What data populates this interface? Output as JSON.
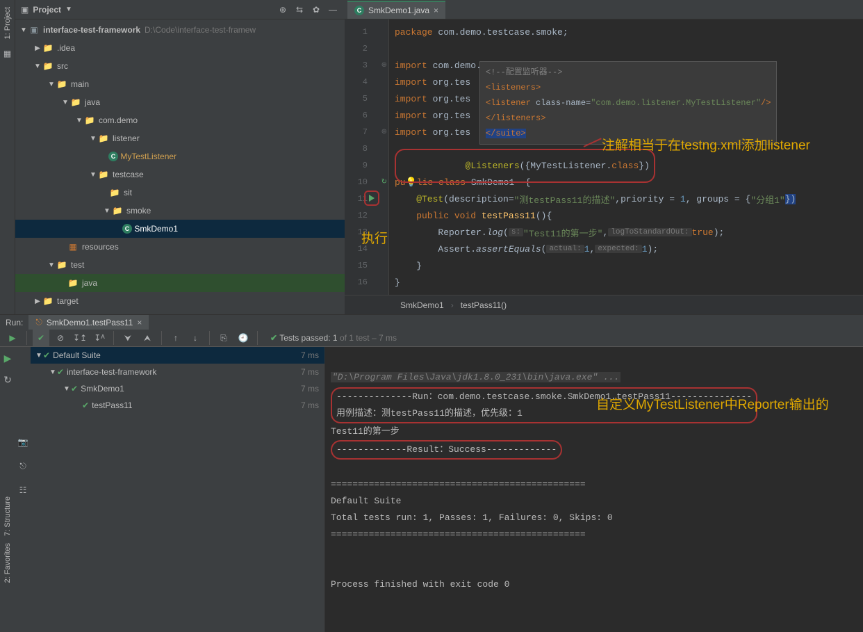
{
  "sidebar_label": "1: Project",
  "project_header": {
    "title": "Project"
  },
  "tree": {
    "root": {
      "name": "interface-test-framework",
      "path": "D:\\Code\\interface-test-framew"
    },
    "idea": ".idea",
    "src": "src",
    "main": "main",
    "java": "java",
    "pkg": "com.demo",
    "listener": "listener",
    "my_listener": "MyTestListener",
    "testcase": "testcase",
    "sit": "sit",
    "smoke": "smoke",
    "smk_demo": "SmkDemo1",
    "resources": "resources",
    "test": "test",
    "test_java": "java",
    "target": "target"
  },
  "tab": {
    "name": "SmkDemo1.java"
  },
  "code": {
    "l1a": "package",
    "l1b": " com.demo.testcase.smoke;",
    "l3a": "import",
    "l3b": " com.demo.listener.MyTestListener;",
    "l4a": "import",
    "l4b": " org.tes",
    "l5a": "import",
    "l5b": " org.tes",
    "l6a": "import",
    "l6b": " org.tes",
    "l7a": "import",
    "l7b": " org.tes",
    "l9a": "@Listeners",
    "l9b": "({MyTestListener.",
    "l9c": "class",
    "l9d": "})",
    "l10a": "pu",
    "l10b": "lic ",
    "l10c": "class",
    "l10d": " SmkDemo1  {",
    "l11a": "    @Test",
    "l11b": "(description=",
    "l11c": "\"测testPass11的描述\"",
    "l11d": ",priority = ",
    "l11e": "1",
    "l11f": ", groups = {",
    "l11g": "\"分组1\"",
    "l11h": "})",
    "l12a": "    public void ",
    "l12b": "testPass11",
    "l12c": "(){",
    "l13a": "        Reporter.",
    "l13b": "log",
    "l13c": "(",
    "l13d": "s:",
    "l13e": "\"Test11的第一步\"",
    "l13f": ",",
    "l13g": "logToStandardOut:",
    "l13h": "true",
    "l13i": ");",
    "l14a": "        Assert.",
    "l14b": "assertEquals",
    "l14c": "(",
    "l14d": "actual:",
    "l14e": "1",
    "l14f": ",",
    "l14g": "expected:",
    "l14h": "1",
    "l14i": ");",
    "l15": "    }",
    "l16": "}"
  },
  "line_numbers": [
    "1",
    "2",
    "3",
    "4",
    "5",
    "6",
    "7",
    "8",
    "9",
    "10",
    "11",
    "12",
    "13",
    "14",
    "15",
    "16"
  ],
  "xml": {
    "comment": "<!--配置监听器-->",
    "open_listeners": "<listeners>",
    "listener_line_a": "<listener ",
    "listener_line_attr": "class-name",
    "listener_line_eq": "=",
    "listener_line_val": "\"com.demo.listener.MyTestListener\"",
    "listener_line_end": "/>",
    "close_listeners": "</listeners>",
    "close_suite": "</suite>"
  },
  "breadcrumb": {
    "a": "SmkDemo1",
    "b": "testPass11()"
  },
  "anno1": "注解相当于在testng.xml添加listener",
  "anno_run": "执行",
  "anno_console": "自定义MyTestListener中Reporter输出的",
  "run": {
    "label": "Run:",
    "tab": "SmkDemo1.testPass11",
    "tests_prefix": "Tests passed:",
    "tests_num": "1",
    "tests_of": " of 1 test",
    "tests_time": " – 7 ms"
  },
  "run_tree": {
    "suite": "Default Suite",
    "proj": "interface-test-framework",
    "cls": "SmkDemo1",
    "test": "testPass11",
    "t1": "7 ms",
    "t2": "7 ms",
    "t3": "7 ms",
    "t4": "7 ms"
  },
  "console": {
    "cmd": "\"D:\\Program Files\\Java\\jdk1.8.0_231\\bin\\java.exe\" ...",
    "run_line": "--------------Run：com.demo.testcase.smoke.SmkDemo1.testPass11---------------",
    "desc_line": "用例描述：测testPass11的描述，优先级：1",
    "step": "Test11的第一步",
    "result": "-------------Result：Success-------------",
    "sep": "===============================================",
    "suite": "Default Suite",
    "totals": "Total tests run: 1, Passes: 1, Failures: 0, Skips: 0",
    "sep2": "===============================================",
    "exit": "Process finished with exit code 0"
  },
  "left_bottom": {
    "structure": "7: Structure",
    "favorites": "2: Favorites"
  }
}
